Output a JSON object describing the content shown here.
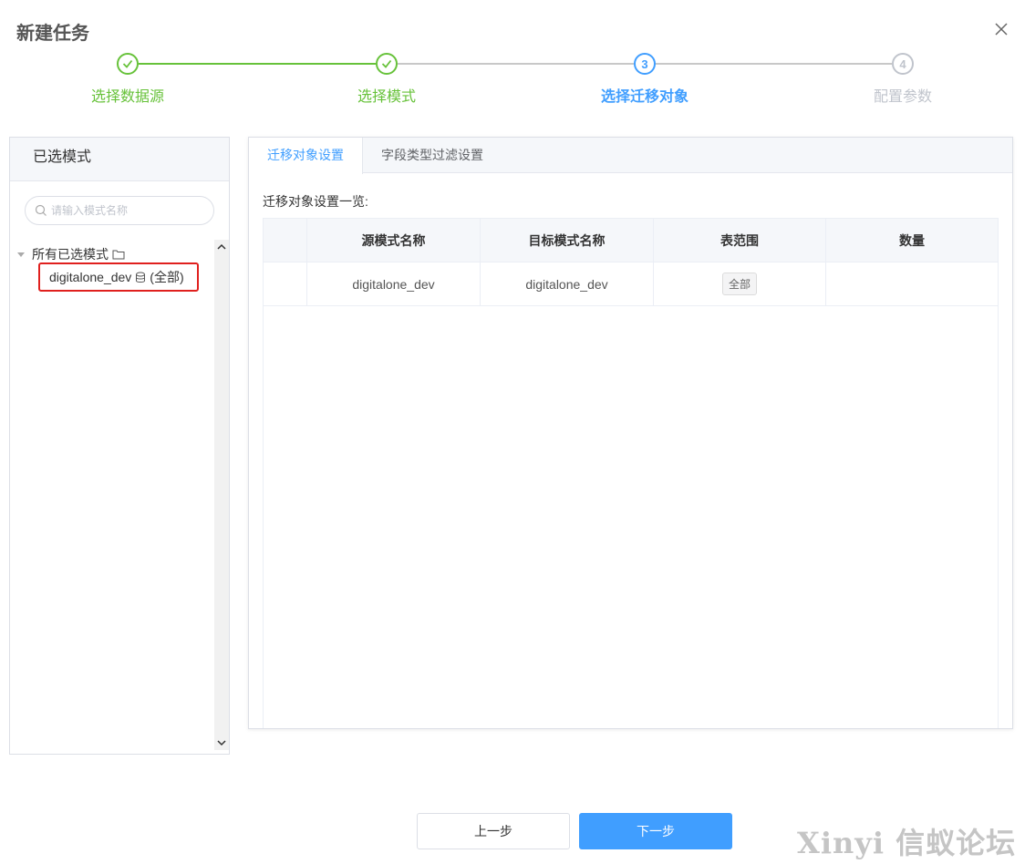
{
  "dialog": {
    "title": "新建任务"
  },
  "steps": [
    {
      "label": "选择数据源",
      "number": "1",
      "status": "done"
    },
    {
      "label": "选择模式",
      "number": "2",
      "status": "done"
    },
    {
      "label": "选择迁移对象",
      "number": "3",
      "status": "active"
    },
    {
      "label": "配置参数",
      "number": "4",
      "status": "pending"
    }
  ],
  "left_panel": {
    "title": "已选模式",
    "search_placeholder": "请输入模式名称",
    "tree_root_label": "所有已选模式",
    "tree_child_label": "digitalone_dev",
    "tree_child_suffix": "(全部)"
  },
  "right_panel": {
    "tabs": [
      {
        "label": "迁移对象设置"
      },
      {
        "label": "字段类型过滤设置"
      }
    ],
    "overview_label": "迁移对象设置一览:",
    "table": {
      "columns": [
        "",
        "源模式名称",
        "目标模式名称",
        "表范围",
        "数量"
      ],
      "rows": [
        {
          "index": "",
          "source": "digitalone_dev",
          "target": "digitalone_dev",
          "scope": "全部",
          "count": ""
        }
      ]
    }
  },
  "footer": {
    "prev_label": "上一步",
    "next_label": "下一步"
  },
  "watermark": "Xinyi 信蚁论坛",
  "colors": {
    "accent": "#409eff",
    "done": "#67c23a",
    "pending": "#c0c4cc",
    "highlight": "#e0201e"
  }
}
